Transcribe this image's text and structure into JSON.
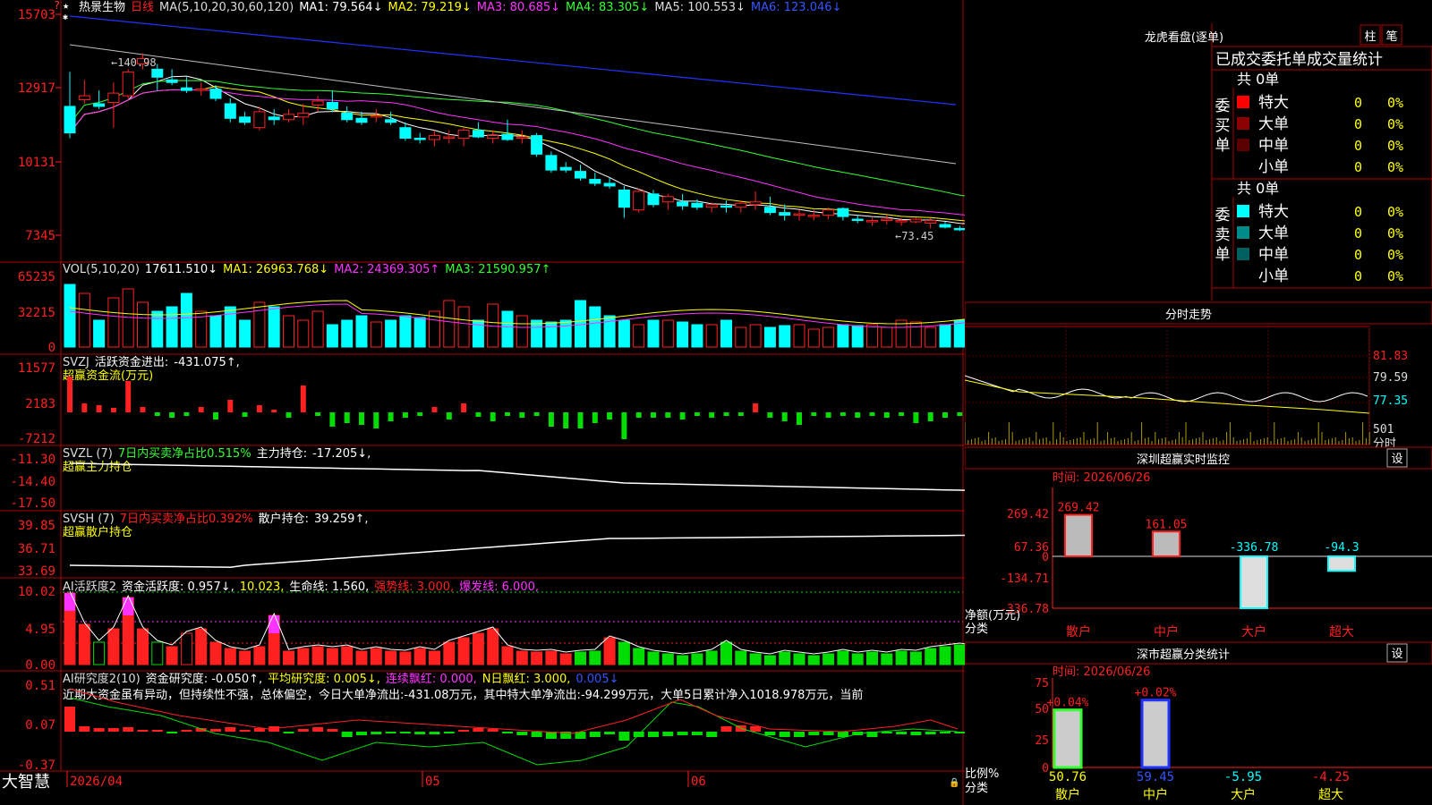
{
  "colors": {
    "up": "#ff2020",
    "down": "#00ffff",
    "ma1": "#ffffff",
    "ma2": "#ffff00",
    "ma3": "#ff33ff",
    "ma4": "#33ff33",
    "ma5": "#c0c0c0",
    "ma6": "#2233ff",
    "green": "#00dd00",
    "frame": "#b00000",
    "orange": "#ffa500"
  },
  "header": {
    "stock": "热景生物",
    "period": "日线",
    "ma_params": "MA(5,10,20,30,60,120)",
    "ma1": "MA1: 79.564↓",
    "ma2": "MA2: 79.219↓",
    "ma3": "MA3: 80.685↓",
    "ma4": "MA4: 83.305↓",
    "ma5": "MA5: 100.553↓",
    "ma6": "MA6: 123.046↓",
    "high_mark": "←140.98",
    "low_mark": "←73.45"
  },
  "price_axis": [
    "15703",
    "12917",
    "10131",
    "7345"
  ],
  "vol": {
    "params": "VOL(5,10,20)",
    "val": "17611.510↓",
    "ma1": "MA1: 26963.768↓",
    "ma2": "MA2: 24369.305↑",
    "ma3": "MA3: 21590.957↑",
    "axis": [
      "65235",
      "32215",
      "0"
    ]
  },
  "svzj": {
    "name": "SVZJ",
    "label": "活跃资金进出:",
    "val": "-431.075↑,",
    "sub": "超赢资金流(万元)",
    "axis": [
      "11577",
      "2183",
      "-7212"
    ]
  },
  "svzl": {
    "name": "SVZL (7)",
    "r1": "7日内买卖净占比0.515%",
    "r2": "主力持仓:",
    "r3": "-17.205↓,",
    "sub": "超赢主力持仓",
    "axis": [
      "-11.30",
      "-14.40",
      "-17.50"
    ]
  },
  "svsh": {
    "name": "SVSH (7)",
    "r1": "7日内买卖净占比0.392%",
    "r2": "散户持仓:",
    "r3": "39.259↑,",
    "sub": "超赢散户持仓",
    "axis": [
      "39.85",
      "36.71",
      "33.69"
    ]
  },
  "ai1": {
    "name": "AI活跃度2",
    "a": "资金活跃度: 0.957↓,",
    "b": "10.023,",
    "c": "生命线: 1.560,",
    "d": "强势线: 3.000,",
    "e": "爆发线: 6.000,",
    "axis": [
      "10.02",
      "4.95",
      "0.00"
    ]
  },
  "ai2": {
    "name": "AI研究度2(10)",
    "a": "资金研究度: -0.050↑,",
    "b": "平均研究度: 0.005↓,",
    "c": "连续飘红: 0.000,",
    "d": "N日飘红: 3.000,",
    "e": "0.005↓",
    "text": "近期大资金虽有异动，但持续性不强，总体偏空，今日大单净流出:-431.08万元，其中特大单净流出:-94.299万元，大单5日累计净入1018.978万元，当前",
    "axis": [
      "0.51",
      "0.07",
      "-0.37"
    ]
  },
  "bottom": {
    "brand": "大智慧",
    "d1": "2026/04",
    "d2": "05",
    "d3": "06"
  },
  "right": {
    "lhb_title": "龙虎看盘(逐单)",
    "btn_zhu": "柱",
    "btn_bi": "笔",
    "stat_title": "已成交委托单成交量统计",
    "buy": {
      "side": "委买单",
      "total": "共 0单",
      "rows": [
        {
          "n": "特大",
          "v": "0",
          "p": "0%",
          "c": "#ff0000"
        },
        {
          "n": "大单",
          "v": "0",
          "p": "0%",
          "c": "#8b0000"
        },
        {
          "n": "中单",
          "v": "0",
          "p": "0%",
          "c": "#5a0000"
        },
        {
          "n": "小单",
          "v": "0",
          "p": "0%",
          "c": "#000"
        }
      ]
    },
    "sell": {
      "side": "委卖单",
      "total": "共 0单",
      "rows": [
        {
          "n": "特大",
          "v": "0",
          "p": "0%",
          "c": "#00ffff"
        },
        {
          "n": "大单",
          "v": "0",
          "p": "0%",
          "c": "#008b8b"
        },
        {
          "n": "中单",
          "v": "0",
          "p": "0%",
          "c": "#006060"
        },
        {
          "n": "小单",
          "v": "0",
          "p": "0%",
          "c": "#000"
        }
      ]
    },
    "trend_title": "分时走势",
    "trend_axis": [
      "81.83",
      "79.59",
      "77.35",
      "501",
      "分时"
    ],
    "mon_title": "深圳超赢实时监控",
    "mon_set": "设",
    "mon_time": "时间: 2026/06/26",
    "mon_axis": [
      "269.42",
      "67.36",
      "0",
      "-134.71",
      "-336.78"
    ],
    "mon_ylab": "净额(万元)",
    "mon_xlab": "分类",
    "mon_bars": [
      {
        "cat": "散户",
        "val": 269.42,
        "label": "269.42"
      },
      {
        "cat": "中户",
        "val": 161.05,
        "label": "161.05"
      },
      {
        "cat": "大户",
        "val": -336.78,
        "label": "-336.78"
      },
      {
        "cat": "超大",
        "val": -94.3,
        "label": "-94.3"
      }
    ],
    "cls_title": "深市超赢分类统计",
    "cls_set": "设",
    "cls_time": "时间: 2026/06/26",
    "cls_axis": [
      "75",
      "50",
      "25",
      "0"
    ],
    "cls_ylab": "比例%",
    "cls_xlab": "分类",
    "cls_bars": [
      {
        "cat": "散户",
        "val": 50.76,
        "top": "+0.04%",
        "label": "50.76"
      },
      {
        "cat": "中户",
        "val": 59.45,
        "top": "+0.02%",
        "label": "59.45"
      },
      {
        "cat": "大户",
        "val": -5.95,
        "top": "",
        "label": "-5.95"
      },
      {
        "cat": "超大",
        "val": -4.25,
        "top": "",
        "label": "-4.25"
      }
    ]
  },
  "chart_data": {
    "type": "candlestick",
    "x_ticks": [
      "2026/04",
      "05",
      "06"
    ],
    "ylim": [
      7345,
      15703
    ],
    "candles": [
      [
        12200,
        13500,
        11000,
        11200
      ],
      [
        12450,
        13200,
        12300,
        12600
      ],
      [
        12300,
        12800,
        12100,
        12200
      ],
      [
        12350,
        13100,
        11400,
        12700
      ],
      [
        12600,
        13600,
        12500,
        13500
      ],
      [
        13800,
        14200,
        13600,
        14000
      ],
      [
        13600,
        13800,
        12800,
        13300
      ],
      [
        13200,
        13600,
        13000,
        13100
      ],
      [
        12900,
        13300,
        12700,
        12800
      ],
      [
        12800,
        13100,
        12600,
        12850
      ],
      [
        12850,
        13000,
        12400,
        12500
      ],
      [
        12300,
        12500,
        11600,
        11750
      ],
      [
        11800,
        12000,
        11500,
        11600
      ],
      [
        11400,
        12200,
        11300,
        12000
      ],
      [
        11800,
        12100,
        11500,
        11700
      ],
      [
        11700,
        12100,
        11600,
        11900
      ],
      [
        11800,
        12300,
        11500,
        11950
      ],
      [
        12250,
        12600,
        12000,
        12400
      ],
      [
        12350,
        12800,
        12000,
        12100
      ],
      [
        11950,
        12200,
        11600,
        11700
      ],
      [
        11750,
        12000,
        11500,
        11600
      ],
      [
        11800,
        12100,
        11600,
        11850
      ],
      [
        11700,
        12000,
        11500,
        11600
      ],
      [
        11400,
        11600,
        10900,
        11000
      ],
      [
        11000,
        11200,
        10800,
        10950
      ],
      [
        10950,
        11300,
        10700,
        11100
      ],
      [
        11000,
        11300,
        10800,
        11050
      ],
      [
        11000,
        11400,
        10700,
        11300
      ],
      [
        11300,
        11600,
        11000,
        11050
      ],
      [
        11000,
        11300,
        10800,
        11100
      ],
      [
        11150,
        11700,
        10900,
        10950
      ],
      [
        11000,
        11300,
        10800,
        11050
      ],
      [
        11100,
        11200,
        10300,
        10400
      ],
      [
        10350,
        10500,
        9700,
        9800
      ],
      [
        9900,
        10100,
        9700,
        9800
      ],
      [
        9750,
        10000,
        9400,
        9500
      ],
      [
        9450,
        9700,
        9200,
        9300
      ],
      [
        9300,
        9500,
        9100,
        9200
      ],
      [
        9050,
        9200,
        8000,
        8400
      ],
      [
        8300,
        9100,
        8200,
        9000
      ],
      [
        8900,
        9050,
        8400,
        8500
      ],
      [
        8600,
        8900,
        8300,
        8800
      ],
      [
        8600,
        8900,
        8300,
        8450
      ],
      [
        8550,
        8700,
        8300,
        8400
      ],
      [
        8400,
        8600,
        8200,
        8500
      ],
      [
        8450,
        8650,
        8200,
        8400
      ],
      [
        8400,
        8650,
        8200,
        8550
      ],
      [
        8500,
        9000,
        8300,
        8600
      ],
      [
        8400,
        8800,
        8100,
        8200
      ],
      [
        8200,
        8500,
        7900,
        8100
      ],
      [
        8100,
        8300,
        7900,
        8150
      ],
      [
        8050,
        8300,
        7900,
        8100
      ],
      [
        8100,
        8400,
        7950,
        8300
      ],
      [
        8350,
        8400,
        7900,
        8050
      ],
      [
        7950,
        8100,
        7800,
        7900
      ],
      [
        7850,
        8000,
        7700,
        7900
      ],
      [
        7900,
        8100,
        7750,
        7950
      ],
      [
        7850,
        8000,
        7700,
        7900
      ],
      [
        7850,
        8000,
        7800,
        7950
      ],
      [
        7800,
        8000,
        7600,
        7900
      ],
      [
        7750,
        7850,
        7600,
        7650
      ],
      [
        7600,
        7700,
        7500,
        7550
      ],
      [
        7700,
        7900,
        7500,
        7800
      ],
      [
        7850,
        8000,
        7700,
        7950
      ],
      [
        7900,
        8050,
        7800,
        7950
      ],
      [
        8000,
        8150,
        7850,
        7900
      ],
      [
        7950,
        8000,
        7700,
        7750
      ],
      [
        7750,
        7800,
        7345,
        7400
      ]
    ]
  }
}
